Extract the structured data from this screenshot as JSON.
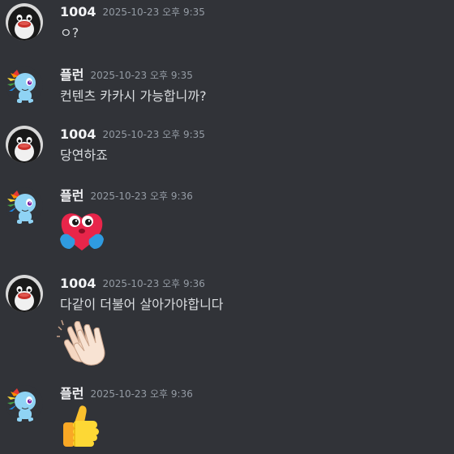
{
  "messages": [
    {
      "username": "1004",
      "timestamp": "2025-10-23 오후 9:35",
      "text": "ㅇ?",
      "avatar": "penguin-avatar"
    },
    {
      "username": "플런",
      "timestamp": "2025-10-23 오후 9:35",
      "text": "컨텐츠 카카시 가능합니까?",
      "avatar": "pony-avatar"
    },
    {
      "username": "1004",
      "timestamp": "2025-10-23 오후 9:35",
      "text": "당연하죠",
      "avatar": "penguin-avatar"
    },
    {
      "username": "플런",
      "timestamp": "2025-10-23 오후 9:36",
      "emoji": "heart-hug-emoji",
      "avatar": "pony-avatar"
    },
    {
      "username": "1004",
      "timestamp": "2025-10-23 오후 9:36",
      "text": "다같이 더불어 살아가야합니다",
      "emoji": "clapping-hands-emoji",
      "avatar": "penguin-avatar"
    },
    {
      "username": "플런",
      "timestamp": "2025-10-23 오후 9:36",
      "emoji": "thumbs-up-emoji",
      "avatar": "pony-avatar"
    }
  ],
  "colors": {
    "background": "#313338",
    "username": "#f2f3f5",
    "timestamp": "#949ba4",
    "text": "#dbdee1"
  }
}
